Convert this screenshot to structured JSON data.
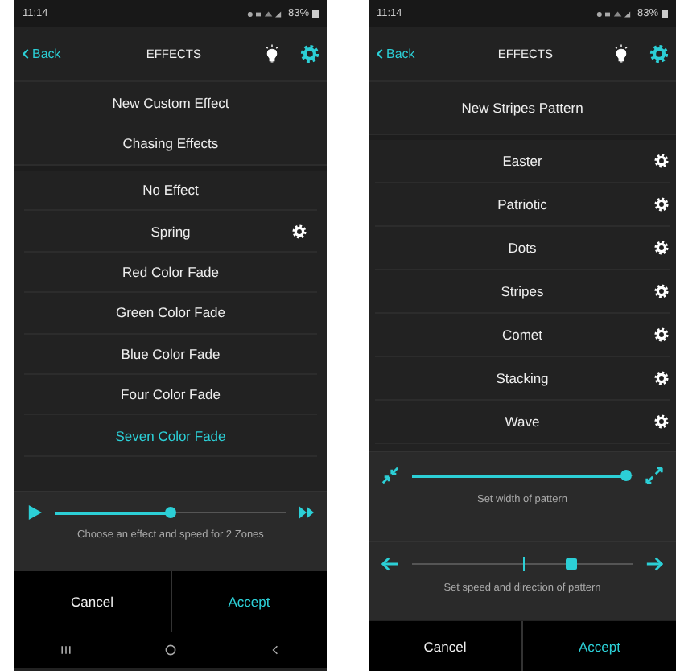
{
  "left_screen": {
    "status_bar": {
      "time": "11:14",
      "battery": "83%"
    },
    "header": {
      "back": "Back",
      "title": "EFFECTS"
    },
    "menu_items": [
      "New Custom Effect",
      "Chasing Effects"
    ],
    "effects": [
      {
        "label": "No Effect",
        "selected": false,
        "settings": false
      },
      {
        "label": "Spring",
        "selected": false,
        "settings": true
      },
      {
        "label": "Red Color Fade",
        "selected": false,
        "settings": false
      },
      {
        "label": "Green Color Fade",
        "selected": false,
        "settings": false
      },
      {
        "label": "Blue Color Fade",
        "selected": false,
        "settings": false
      },
      {
        "label": "Four Color Fade",
        "selected": false,
        "settings": false
      },
      {
        "label": "Seven Color Fade",
        "selected": true,
        "settings": false
      }
    ],
    "speed_slider": {
      "level": 0.5,
      "caption": "Choose an effect and speed for 2 Zones"
    },
    "buttons": [
      "Cancel",
      "Accept"
    ]
  },
  "right_screen": {
    "status_bar": {
      "time": "11:14",
      "battery": "83%"
    },
    "header": {
      "back": "Back",
      "title": "EFFECTS"
    },
    "menu_items": [
      "New Stripes Pattern"
    ],
    "patterns": [
      {
        "label": "Easter",
        "settings": true
      },
      {
        "label": "Patriotic",
        "settings": true
      },
      {
        "label": "Dots",
        "settings": true
      },
      {
        "label": "Stripes",
        "settings": true
      },
      {
        "label": "Comet",
        "settings": true
      },
      {
        "label": "Stacking",
        "settings": true
      },
      {
        "label": "Wave",
        "settings": true
      }
    ],
    "width_slider": {
      "level": 0.97,
      "caption": "Set width of pattern"
    },
    "speed_slider": {
      "level": 0.72,
      "caption": "Set speed and direction of pattern"
    },
    "buttons": [
      "Cancel",
      "Accept"
    ]
  }
}
